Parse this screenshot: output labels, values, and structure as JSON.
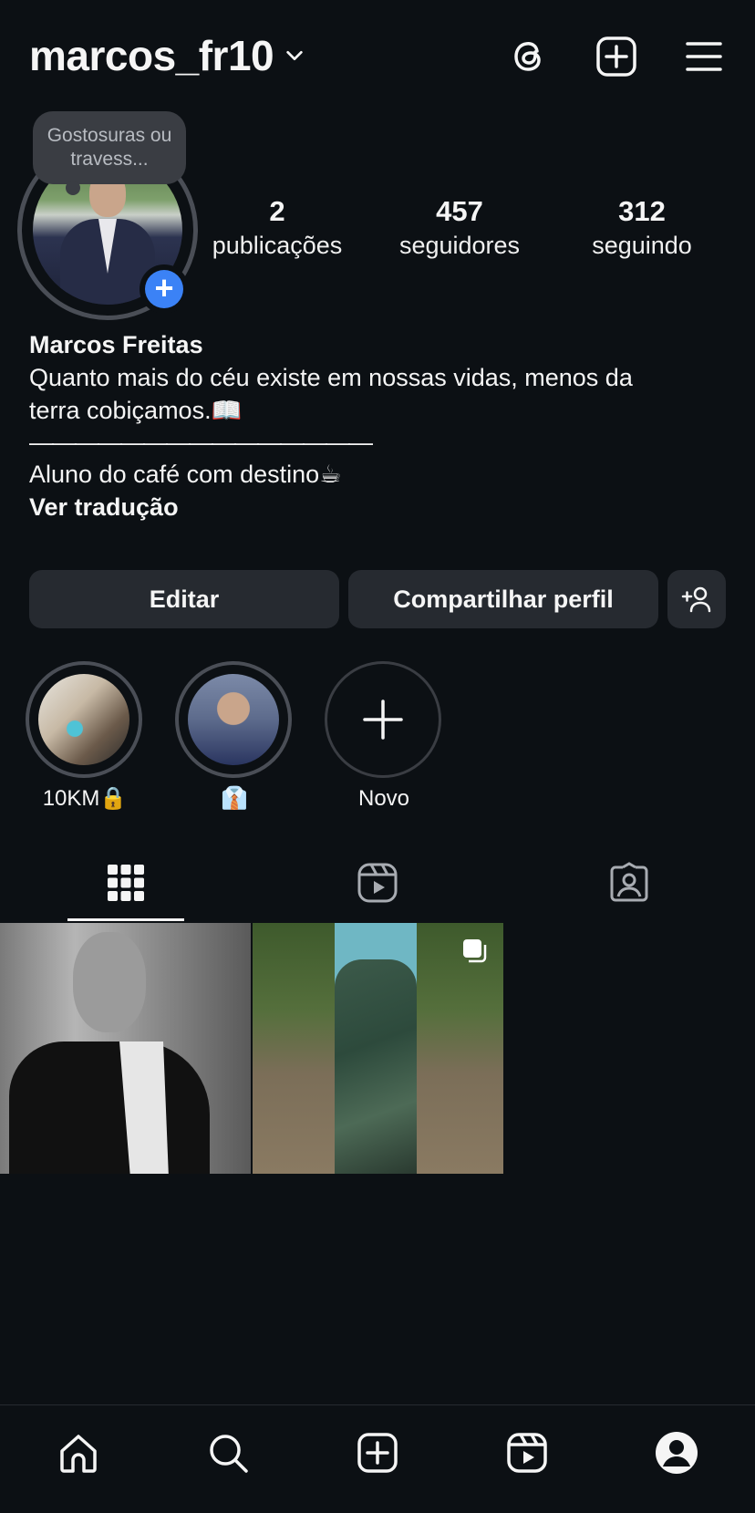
{
  "header": {
    "username": "marcos_fr10",
    "icons": [
      "threads-icon",
      "new-post-icon",
      "menu-icon"
    ]
  },
  "profile": {
    "note": "Gostosuras ou travess...",
    "stats": {
      "posts": {
        "value": "2",
        "label": "publicações"
      },
      "followers": {
        "value": "457",
        "label": "seguidores"
      },
      "following": {
        "value": "312",
        "label": "seguindo"
      }
    },
    "name": "Marcos Freitas",
    "bio_line1": "Quanto mais do céu existe em nossas vidas, menos da",
    "bio_line2": "terra cobiçamos.📖",
    "bio_divider": "———————————————",
    "bio_line3": "Aluno do café com destino☕",
    "translate": "Ver tradução"
  },
  "actions": {
    "edit": "Editar",
    "share": "Compartilhar perfil"
  },
  "highlights": [
    {
      "label": "10KM🔒"
    },
    {
      "label": "👔"
    },
    {
      "label": "Novo"
    }
  ],
  "tabs": [
    "grid-icon",
    "reels-icon",
    "tagged-icon"
  ],
  "colors": {
    "background": "#0c1014",
    "button": "#262a30",
    "accent": "#3b82f6",
    "text": "#f5f5f5"
  },
  "bottom_nav": [
    "home-icon",
    "search-icon",
    "create-icon",
    "reels-icon",
    "profile-icon"
  ]
}
